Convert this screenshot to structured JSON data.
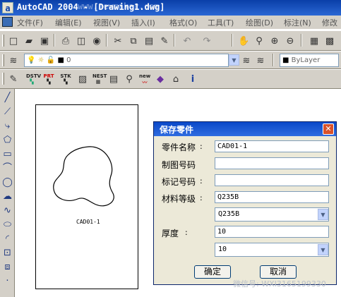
{
  "window": {
    "app_icon": "a",
    "title": "AutoCAD 2004 - [Drawing1.dwg]",
    "watermark_top": "www.newmaker.com"
  },
  "menu": {
    "items": [
      {
        "label": "文件(F)"
      },
      {
        "label": "编辑(E)"
      },
      {
        "label": "视图(V)"
      },
      {
        "label": "插入(I)"
      },
      {
        "label": "格式(O)"
      },
      {
        "label": "工具(T)"
      },
      {
        "label": "绘图(D)"
      },
      {
        "label": "标注(N)"
      },
      {
        "label": "修改"
      }
    ]
  },
  "layer_toolbar": {
    "layer_value": "0",
    "color_value": "ByLayer"
  },
  "custom_toolbar": {
    "labels": [
      "DSTV",
      "PRT",
      "STK",
      "",
      "NEST",
      "",
      "new",
      "",
      "",
      "i"
    ]
  },
  "drawing": {
    "part_label": "CAD01-1"
  },
  "dialog": {
    "title": "保存零件",
    "close_glyph": "✕",
    "fields": [
      {
        "label": "零件名称",
        "value": "CAD01-1"
      },
      {
        "label": "制图号码",
        "value": ""
      },
      {
        "label": "标记号码",
        "value": ""
      },
      {
        "label": "材料等级",
        "value": "Q235B"
      }
    ],
    "material_select": "Q235B",
    "thickness": {
      "label": "厚度",
      "value": "10"
    },
    "thickness_select": "10",
    "ok_label": "确定",
    "cancel_label": "取消",
    "colon": ":"
  },
  "footer": {
    "watermark": "微信号: WXI3165199330"
  },
  "colors": {
    "title_bar": "#0a3fa8",
    "dialog_title": "#0a48c8",
    "dialog_bg": "#ece9d8",
    "toolbar_bg": "#d4d0c8"
  }
}
